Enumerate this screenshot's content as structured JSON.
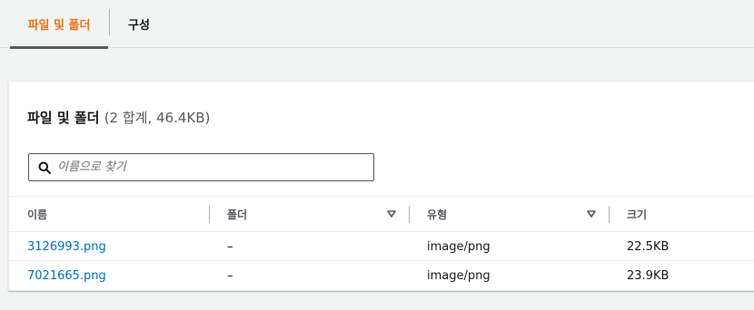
{
  "tabs": [
    {
      "label": "파일 및 폴더"
    },
    {
      "label": "구성"
    }
  ],
  "panel": {
    "title": "파일 및 폴더",
    "count": "(2 합계, 46.4KB)"
  },
  "search": {
    "placeholder": "이름으로 찾기",
    "value": ""
  },
  "table": {
    "columns": [
      "이름",
      "폴더",
      "유형",
      "크기"
    ],
    "rows": [
      {
        "name": "3126993.png",
        "folder": "–",
        "type": "image/png",
        "size": "22.5KB"
      },
      {
        "name": "7021665.png",
        "folder": "–",
        "type": "image/png",
        "size": "23.9KB"
      }
    ]
  },
  "colors": {
    "active_tab": "#ec7211",
    "link": "#0073bb"
  }
}
